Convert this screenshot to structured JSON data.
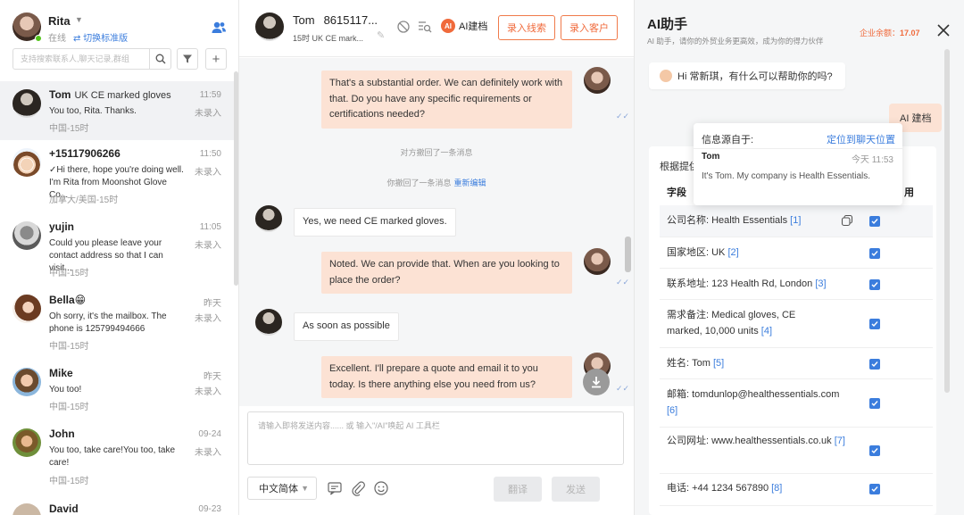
{
  "user": {
    "name": "Rita",
    "status": "在线",
    "switch_label": "⇄ 切换标准版"
  },
  "search": {
    "placeholder": "支持搜索联系人,聊天记录,群组"
  },
  "conversations": [
    {
      "name": "Tom",
      "title": "UK CE marked gloves",
      "time": "11:59",
      "message": "You too, Rita. Thanks.",
      "flag": "未录入",
      "meta": "中国-15时"
    },
    {
      "name": "+15117906266",
      "title": "",
      "time": "11:50",
      "message": "✓Hi there, hope you're doing well. I'm Rita from Moonshot Glove Co...",
      "flag": "未录入",
      "meta": "加拿大/美国-15时"
    },
    {
      "name": "yujin",
      "title": "",
      "time": "11:05",
      "message": "Could you please leave your contact address so that I can visit...",
      "flag": "未录入",
      "meta": "中国-15时"
    },
    {
      "name": "Bella😁",
      "title": "",
      "time": "昨天",
      "message": "Oh sorry, it's the mailbox. The phone is 125799494666",
      "flag": "未录入",
      "meta": "中国-15时"
    },
    {
      "name": "Mike",
      "title": "",
      "time": "昨天",
      "message": "You too!",
      "flag": "未录入",
      "meta": "中国-15时"
    },
    {
      "name": "John",
      "title": "",
      "time": "09-24",
      "message": "You too, take care!You too, take care!",
      "flag": "未录入",
      "meta": "中国-15时"
    },
    {
      "name": "David",
      "title": "",
      "time": "09-23",
      "message": "",
      "flag": "",
      "meta": ""
    }
  ],
  "chat": {
    "name": "Tom",
    "phone": "8615117...",
    "sub": "15时 UK CE mark...",
    "ai_file_label": "AI建档",
    "ai_badge": "AI",
    "btn_lead": "录入线索",
    "btn_customer": "录入客户",
    "messages": [
      {
        "text": "That's a substantial order. We can definitely work with that. Do you have any specific requirements or certifications needed?"
      },
      {
        "text": "Yes, we need CE marked gloves."
      },
      {
        "text": "Noted. We can provide that. When are you looking to place the order?"
      },
      {
        "text": "As soon as possible"
      },
      {
        "text": "Excellent. I'll prepare a quote and email it to you today. Is there anything else you need from us?"
      }
    ],
    "sys_recall_other": "对方撤回了一条消息",
    "sys_recall_self": "你撤回了一条消息",
    "sys_reedit": "重新编辑",
    "input_placeholder": "请输入即将发送内容...... 或 输入\"/AI\"唤起 AI 工具栏",
    "language": "中文简体",
    "btn_translate": "翻译",
    "btn_send": "发送"
  },
  "ai": {
    "title": "AI助手",
    "subtitle": "AI 助手，请你的外贸业务更高效，成为你的得力伙伴",
    "balance_label": "企业余额：",
    "balance_value": "17.07",
    "greeting": "Hi 常新琪，有什么可以帮助你的吗?",
    "user_cmd": "AI 建档",
    "card_head": "根据提供",
    "col_field": "字段",
    "col_use": "用",
    "fields": [
      {
        "text": "公司名称: Health Essentials ",
        "ref": "[1]"
      },
      {
        "text": "国家地区: UK ",
        "ref": "[2]"
      },
      {
        "text": "联系地址: 123 Health Rd, London ",
        "ref": "[3]"
      },
      {
        "text": "需求备注: Medical gloves, CE marked, 10,000 units ",
        "ref": "[4]"
      },
      {
        "text": "姓名: Tom ",
        "ref": "[5]"
      },
      {
        "text": "邮箱: tomdunlop@healthessentials.com ",
        "ref": "[6]"
      },
      {
        "text": "公司网址: www.healthessentials.co.uk ",
        "ref": "[7]"
      },
      {
        "text": "电话: +44 1234 567890 ",
        "ref": "[8]"
      }
    ],
    "tooltip": {
      "source_label": "信息源自于:",
      "locate": "定位到聊天位置",
      "name": "Tom",
      "time": "今天 11:53",
      "body": "It's Tom. My company is Health Essentials."
    }
  }
}
